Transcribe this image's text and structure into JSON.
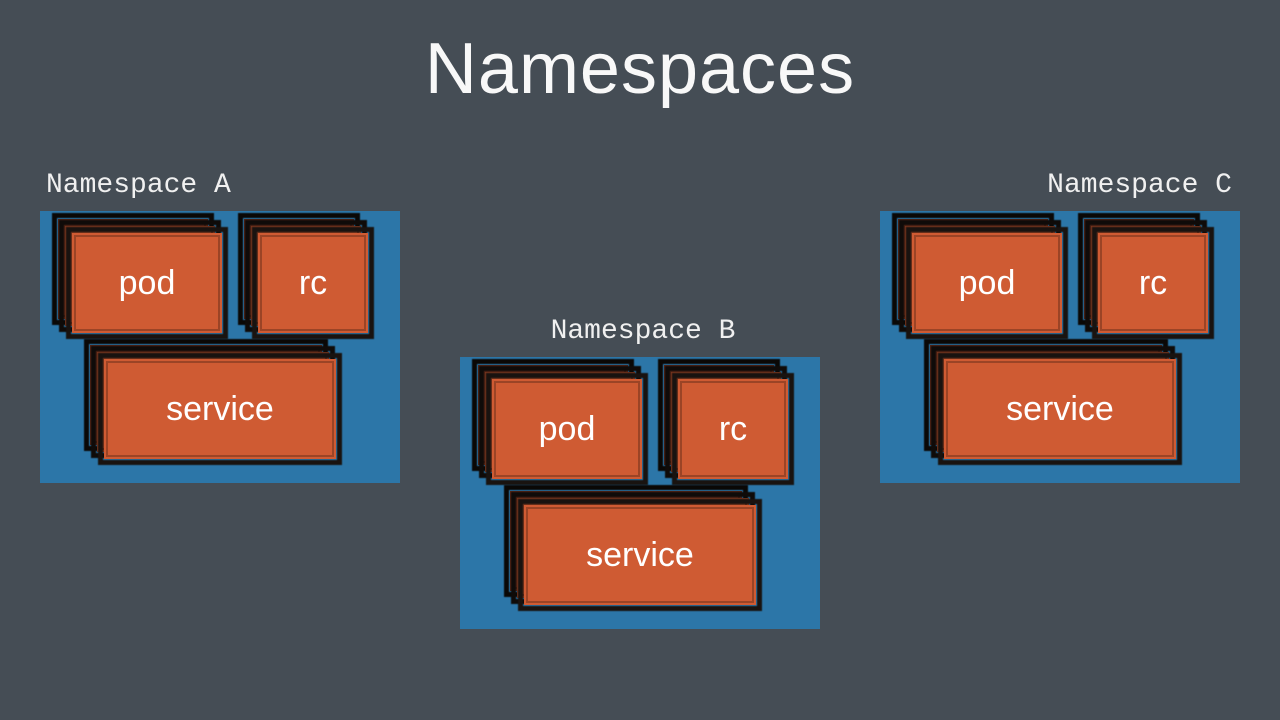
{
  "title": "Namespaces",
  "namespaces": {
    "a": {
      "label": "Namespace A",
      "items": {
        "pod": "pod",
        "rc": "rc",
        "service": "service"
      }
    },
    "b": {
      "label": "Namespace B",
      "items": {
        "pod": "pod",
        "rc": "rc",
        "service": "service"
      }
    },
    "c": {
      "label": "Namespace C",
      "items": {
        "pod": "pod",
        "rc": "rc",
        "service": "service"
      }
    }
  },
  "colors": {
    "background": "#454d55",
    "box": "#2c76a8",
    "card": "#cf5b33",
    "text": "#f5f5f5"
  }
}
